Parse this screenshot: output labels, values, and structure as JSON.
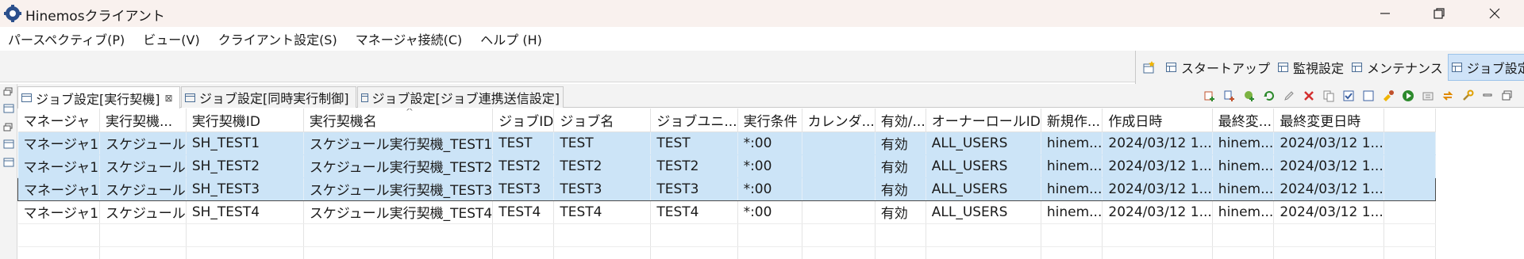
{
  "window": {
    "title": "Hinemosクライアント",
    "minimize_icon": "minimize-icon",
    "restore_icon": "restore-icon",
    "close_icon": "close-icon"
  },
  "menu": [
    "パースペクティブ(P)",
    "ビュー(V)",
    "クライアント設定(S)",
    "マネージャ接続(C)",
    "ヘルプ (H)"
  ],
  "perspectives": {
    "items": [
      "スタートアップ",
      "監視設定",
      "メンテナンス",
      "ジョブ設定"
    ],
    "active": "ジョブ設定"
  },
  "tabs": [
    {
      "label": "ジョブ設定[実行契機]",
      "active": true,
      "close": "⊠"
    },
    {
      "label": "ジョブ設定[同時実行制御]",
      "active": false
    },
    {
      "label": "ジョブ設定[ジョブ連携送信設定]",
      "active": false
    }
  ],
  "table": {
    "columns": [
      "マネージャ",
      "実行契機...",
      "実行契機ID",
      "実行契機名",
      "ジョブID",
      "ジョブ名",
      "ジョブユニ...",
      "実行条件",
      "カレンダ...",
      "有効/...",
      "オーナーロールID",
      "新規作...",
      "作成日時",
      "最終変...",
      "最終変更日時"
    ],
    "sort_indicator": "^",
    "rows": [
      [
        "マネージャ1",
        "スケジュール",
        "SH_TEST1",
        "スケジュール実行契機_TEST1",
        "TEST",
        "TEST",
        "TEST",
        "*:00",
        "",
        "有効",
        "ALL_USERS",
        "hinem...",
        "2024/03/12 1...",
        "hinem...",
        "2024/03/12 1..."
      ],
      [
        "マネージャ1",
        "スケジュール",
        "SH_TEST2",
        "スケジュール実行契機_TEST2",
        "TEST2",
        "TEST2",
        "TEST2",
        "*:00",
        "",
        "有効",
        "ALL_USERS",
        "hinem...",
        "2024/03/12 1...",
        "hinem...",
        "2024/03/12 1..."
      ],
      [
        "マネージャ1",
        "スケジュール",
        "SH_TEST3",
        "スケジュール実行契機_TEST3",
        "TEST3",
        "TEST3",
        "TEST3",
        "*:00",
        "",
        "有効",
        "ALL_USERS",
        "hinem...",
        "2024/03/12 1...",
        "hinem...",
        "2024/03/12 1..."
      ],
      [
        "マネージャ1",
        "スケジュール",
        "SH_TEST4",
        "スケジュール実行契機_TEST4",
        "TEST4",
        "TEST4",
        "TEST4",
        "*:00",
        "",
        "有効",
        "ALL_USERS",
        "hinem...",
        "2024/03/12 1...",
        "hinem...",
        "2024/03/12 1..."
      ]
    ],
    "selected_rows": [
      0,
      1,
      2
    ],
    "focused_row": 2
  },
  "colors": {
    "selection": "#cce4f7",
    "titlebar": "#f9f1ee",
    "active_perspective": "#cfe3f8"
  }
}
